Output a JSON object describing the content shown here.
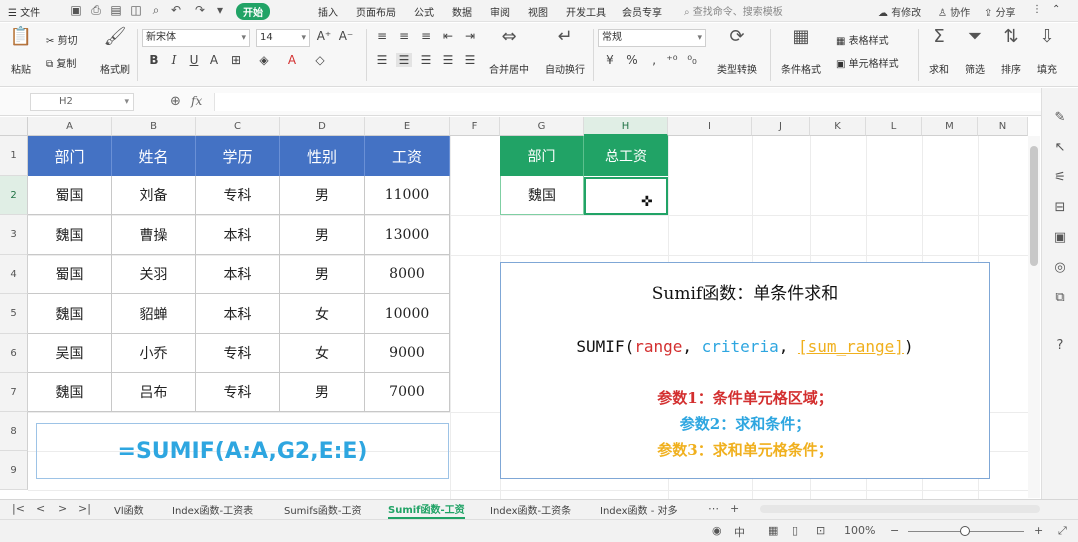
{
  "menu": {
    "file": "文件",
    "tabs": [
      "开始",
      "插入",
      "页面布局",
      "公式",
      "数据",
      "审阅",
      "视图",
      "开发工具",
      "会员专享"
    ],
    "search_placeholder": "查找命令、搜索模板",
    "right": [
      "有修改",
      "协作",
      "分享"
    ]
  },
  "ribbon": {
    "paste": "粘贴",
    "cut": "剪切",
    "copy": "复制",
    "format_painter": "格式刷",
    "font_name": "新宋体",
    "font_size": "14",
    "merge_center": "合并居中",
    "wrap_text": "自动换行",
    "number_format": "常规",
    "type_convert": "类型转换",
    "cond_format": "条件格式",
    "table_style": "表格样式",
    "cell_style": "单元格样式",
    "sum": "求和",
    "filter": "筛选",
    "sort": "排序",
    "fill": "填充"
  },
  "formula_bar": {
    "name_box": "H2",
    "fx": "fx"
  },
  "grid": {
    "columns": [
      "A",
      "B",
      "C",
      "D",
      "E",
      "F",
      "G",
      "H",
      "I",
      "J",
      "K",
      "L",
      "M",
      "N"
    ],
    "selected_column": "H",
    "rows": [
      "1",
      "2",
      "3",
      "4",
      "5",
      "6",
      "7",
      "8",
      "9"
    ],
    "selected_row": "2",
    "table": {
      "headers": [
        "部门",
        "姓名",
        "学历",
        "性别",
        "工资"
      ],
      "rows": [
        [
          "蜀国",
          "刘备",
          "专科",
          "男",
          "11000"
        ],
        [
          "魏国",
          "曹操",
          "本科",
          "男",
          "13000"
        ],
        [
          "蜀国",
          "关羽",
          "本科",
          "男",
          "8000"
        ],
        [
          "魏国",
          "貂蝉",
          "本科",
          "女",
          "10000"
        ],
        [
          "吴国",
          "小乔",
          "专科",
          "女",
          "9000"
        ],
        [
          "魏国",
          "吕布",
          "专科",
          "男",
          "7000"
        ]
      ]
    },
    "lookup": {
      "headers": [
        "部门",
        "总工资"
      ],
      "criteria": "魏国",
      "result": ""
    },
    "formula_display": "=SUMIF(A:A,G2,E:E)",
    "info": {
      "title": "Sumif函数：单条件求和",
      "syntax_prefix": "SUMIF(",
      "arg_range": "range",
      "sep1": ", ",
      "arg_criteria": "criteria",
      "sep2": ", ",
      "arg_sum_range": "[sum_range]",
      "syntax_suffix": ")",
      "param1": "参数1：条件单元格区域；",
      "param2": "参数2：求和条件；",
      "param3": "参数3：求和单元格条件；"
    }
  },
  "sheet_tabs": [
    "Vl函数",
    "Index函数-工资表",
    "Sumifs函数-工资",
    "Sumif函数-工资",
    "Index函数-工资条",
    "Index函数 - 对多"
  ],
  "active_sheet": "Sumif函数-工资",
  "status": {
    "zoom": "100%"
  },
  "colors": {
    "accent": "#21a366",
    "table_header": "#4472c4",
    "formula_text": "#2ea6e0",
    "param1": "#d32f2f",
    "param2": "#2ea6e0",
    "param3": "#f0b01e"
  }
}
